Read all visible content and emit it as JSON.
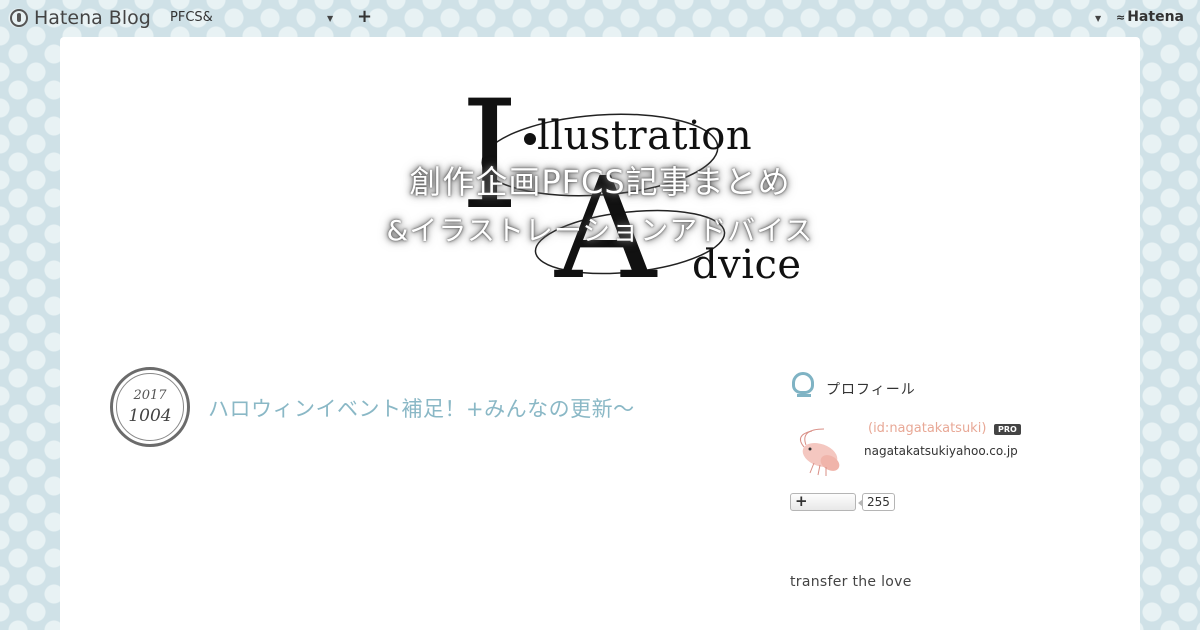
{
  "topbar": {
    "brand": "Hatena Blog",
    "blog_selector": "PFCS&",
    "add_symbol": "+",
    "account_menu": "Hatena"
  },
  "header": {
    "logo_letter_i": "I",
    "logo_letter_a": "A",
    "logo_word_1": "llustration",
    "logo_word_2": "dvice",
    "title": "創作企画PFCS記事まとめ",
    "subtitle": "&イラストレーションアドバイス"
  },
  "entry": {
    "date_year": "2017",
    "date_monthday": "1004",
    "title": "ハロウィンイベント補足！+みんなの更新〜"
  },
  "sidebar": {
    "profile_heading": "プロフィール",
    "user_id": "(id:nagatakatsuki)",
    "pro_badge": "PRO",
    "description": "nagatakatsukiyahoo.co.jp",
    "subscribe_symbol": "+",
    "subscriber_count": "255",
    "tagline": "transfer the love"
  },
  "colors": {
    "background": "#cfe1e7",
    "polka_dot": "#e8f2f4",
    "entry_title": "#8ab8c6",
    "profile_icon": "#7fb3c4",
    "user_id": "#e8a896"
  }
}
